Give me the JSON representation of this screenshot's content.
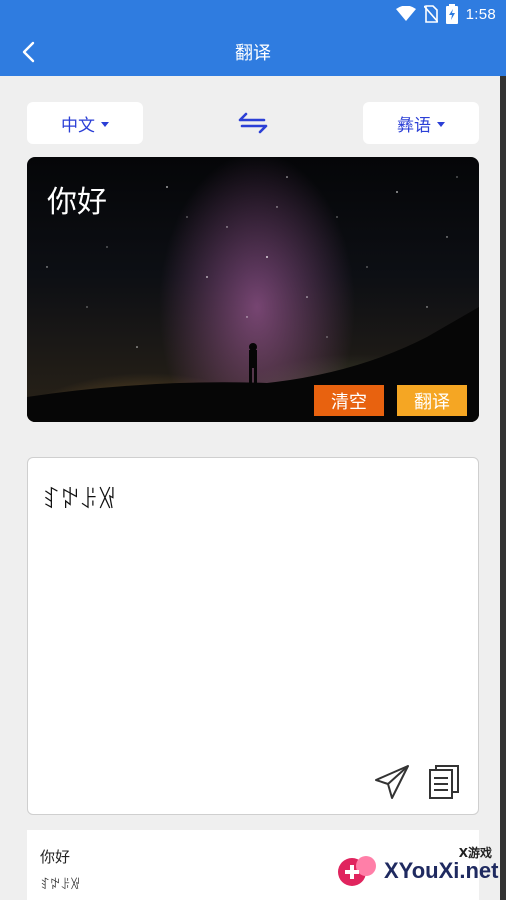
{
  "status_bar": {
    "time": "1:58",
    "icons": [
      "wifi-icon",
      "no-sim-icon",
      "battery-charging-icon"
    ]
  },
  "app_bar": {
    "title": "翻译",
    "back_icon": "chevron-left-icon",
    "color": "#2f7ce0"
  },
  "languages": {
    "source": "中文",
    "target": "彝语",
    "swap_icon": "swap-arrows-icon"
  },
  "input": {
    "value": "你好",
    "clear_label": "清空",
    "translate_label": "翻译",
    "clear_color": "#e8620f",
    "translate_color": "#f5a623"
  },
  "output": {
    "text": "ꆏꉢꌠꑟ",
    "send_icon": "paper-plane-icon",
    "copy_icon": "copy-icon"
  },
  "history": [
    {
      "source": "你好",
      "result": "ꆏꉢꌠꑟ"
    }
  ],
  "watermark": {
    "top": "X游戏",
    "main": "XYouXi.net"
  }
}
